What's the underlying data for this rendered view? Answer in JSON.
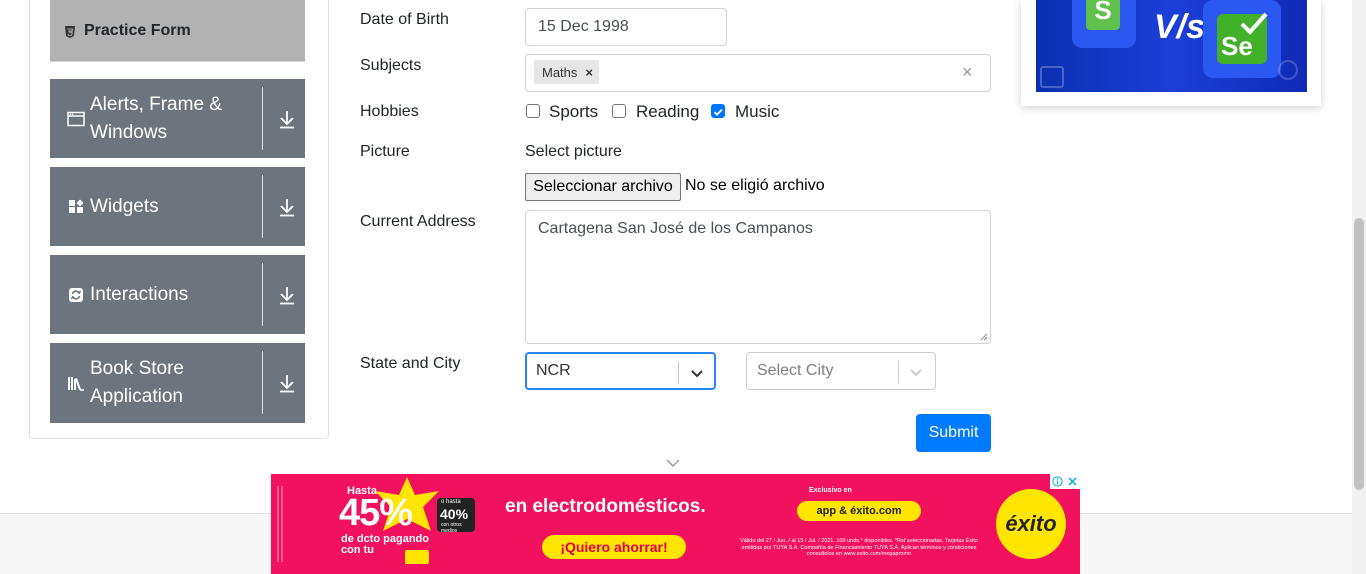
{
  "sidebar": {
    "practice_form": "Practice Form",
    "groups": [
      {
        "label": "Alerts, Frame & Windows",
        "icon": "window-icon"
      },
      {
        "label": "Widgets",
        "icon": "widgets-icon"
      },
      {
        "label": "Interactions",
        "icon": "interactions-icon"
      },
      {
        "label": "Book Store Application",
        "icon": "book-icon"
      }
    ]
  },
  "form": {
    "dob_label": "Date of Birth",
    "dob_value": "15 Dec 1998",
    "subjects_label": "Subjects",
    "subject_chip": "Maths",
    "chip_remove": "×",
    "clear_all": "×",
    "hobbies_label": "Hobbies",
    "hobbies": [
      {
        "label": "Sports",
        "checked": false
      },
      {
        "label": "Reading",
        "checked": false
      },
      {
        "label": "Music",
        "checked": true
      }
    ],
    "picture_label": "Picture",
    "select_picture": "Select picture",
    "file_button": "Seleccionar archivo",
    "file_status": "No se eligió archivo",
    "address_label": "Current Address",
    "address_value": "Cartagena San José de los Campanos",
    "state_city_label": "State and City",
    "state_value": "NCR",
    "city_placeholder": "Select City",
    "submit": "Submit"
  },
  "ads": {
    "bottom": {
      "hasta": "Hasta",
      "percent": "45%",
      "o_hasta": "o hasta",
      "forty": "40%",
      "con_otros": "con otros medios",
      "dcto": "de dcto pagando con tu",
      "headline": "en electrodomésticos.",
      "cta": "¡Quiero ahorrar!",
      "exclusivo": "Exclusivo en",
      "app": "app & éxito.com",
      "fine_print": "Válido del 27 / Jun. / al 15 / Jul. / 2021. 100 unds.* disponibles. *Ref seleccionadas. Tarjetas Éxito emitidas por TUYA S.A. Compañía de Financiamiento TUYA S.A. Aplican términos y condiciones consultelos en www.exito.com/megapromo",
      "brand": "éxito"
    },
    "right": {
      "vs": "V/s",
      "left_logo": "S",
      "right_logo": "Se"
    }
  },
  "colors": {
    "sidebar_group": "#6c757d",
    "practice_active": "#b2b2b2",
    "primary": "#007bff",
    "checkbox_checked": "#0075ff",
    "ad_pink": "#f1115f",
    "ad_yellow": "#ffe500"
  }
}
